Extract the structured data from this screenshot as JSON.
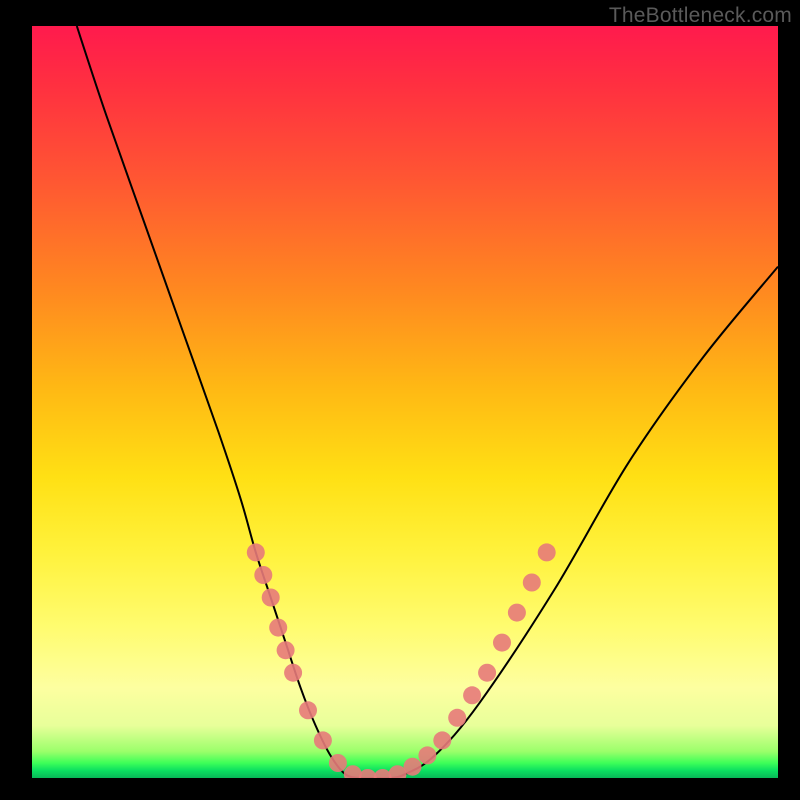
{
  "watermark": "TheBottleneck.com",
  "chart_data": {
    "type": "line",
    "title": "",
    "xlabel": "",
    "ylabel": "",
    "xlim": [
      0,
      100
    ],
    "ylim": [
      0,
      100
    ],
    "series": [
      {
        "name": "bottleneck-curve",
        "x": [
          6,
          10,
          15,
          20,
          25,
          28,
          30,
          32,
          34,
          36,
          38,
          40,
          42,
          44,
          46,
          48,
          50,
          54,
          60,
          70,
          80,
          90,
          100
        ],
        "values": [
          100,
          88,
          74,
          60,
          46,
          37,
          30,
          24,
          18,
          12,
          7,
          3,
          0.5,
          0,
          0,
          0,
          0.5,
          3,
          10,
          25,
          42,
          56,
          68
        ]
      }
    ],
    "markers": {
      "name": "highlighted-points",
      "color": "#e77a7a",
      "points": [
        {
          "x": 30,
          "y": 30
        },
        {
          "x": 31,
          "y": 27
        },
        {
          "x": 32,
          "y": 24
        },
        {
          "x": 33,
          "y": 20
        },
        {
          "x": 34,
          "y": 17
        },
        {
          "x": 35,
          "y": 14
        },
        {
          "x": 37,
          "y": 9
        },
        {
          "x": 39,
          "y": 5
        },
        {
          "x": 41,
          "y": 2
        },
        {
          "x": 43,
          "y": 0.5
        },
        {
          "x": 45,
          "y": 0
        },
        {
          "x": 47,
          "y": 0
        },
        {
          "x": 49,
          "y": 0.5
        },
        {
          "x": 51,
          "y": 1.5
        },
        {
          "x": 53,
          "y": 3
        },
        {
          "x": 55,
          "y": 5
        },
        {
          "x": 57,
          "y": 8
        },
        {
          "x": 59,
          "y": 11
        },
        {
          "x": 61,
          "y": 14
        },
        {
          "x": 63,
          "y": 18
        },
        {
          "x": 65,
          "y": 22
        },
        {
          "x": 67,
          "y": 26
        },
        {
          "x": 69,
          "y": 30
        }
      ]
    }
  }
}
